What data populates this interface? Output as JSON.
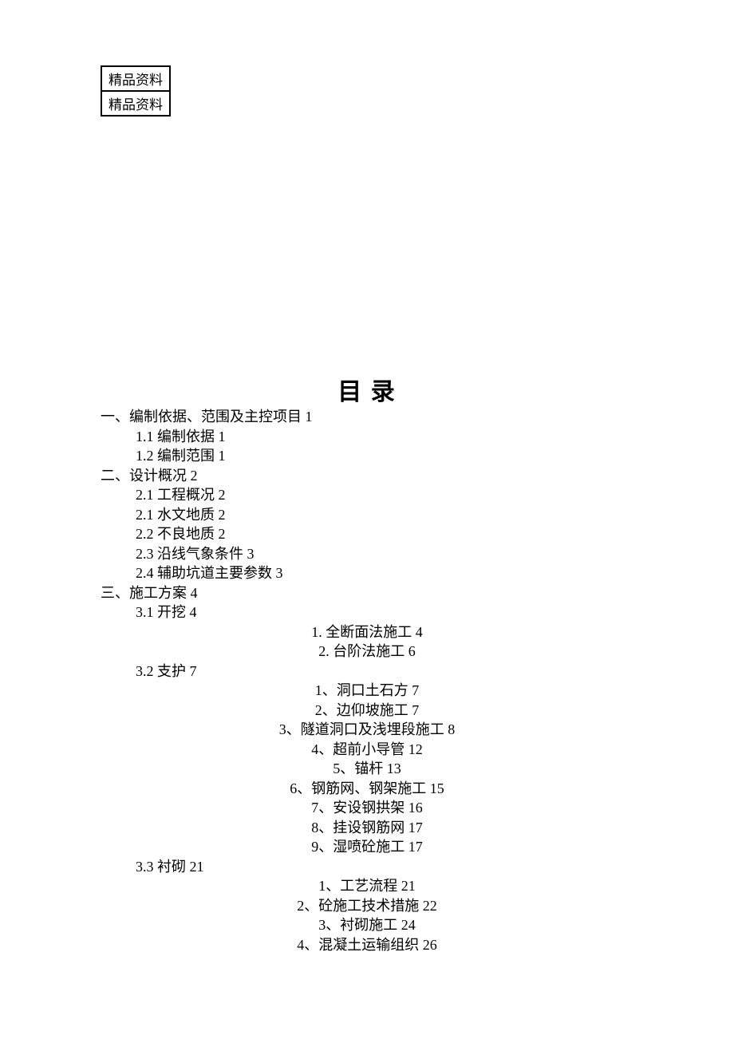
{
  "stamp": {
    "row1": "精品资料",
    "row2": "精品资料"
  },
  "title": "目 录",
  "toc": [
    {
      "cls": "lvl1",
      "text": "一、编制依据、范围及主控项目 1"
    },
    {
      "cls": "lvl2",
      "text": "1.1 编制依据 1"
    },
    {
      "cls": "lvl2",
      "text": "1.2 编制范围 1"
    },
    {
      "cls": "lvl1",
      "text": "二、设计概况 2"
    },
    {
      "cls": "lvl2",
      "text": "2.1 工程概况 2"
    },
    {
      "cls": "lvl2",
      "text": "2.1 水文地质 2"
    },
    {
      "cls": "lvl2",
      "text": "2.2 不良地质 2"
    },
    {
      "cls": "lvl2",
      "text": "2.3 沿线气象条件 3"
    },
    {
      "cls": "lvl2",
      "text": "2.4 辅助坑道主要参数 3"
    },
    {
      "cls": "lvl1",
      "text": "三、施工方案 4"
    },
    {
      "cls": "lvl2",
      "text": "3.1 开挖 4"
    },
    {
      "cls": "lvl3",
      "text": "1. 全断面法施工 4"
    },
    {
      "cls": "lvl3",
      "text": "2. 台阶法施工 6"
    },
    {
      "cls": "lvl2",
      "text": "3.2 支护 7"
    },
    {
      "cls": "lvl3",
      "text": "1、洞口土石方 7"
    },
    {
      "cls": "lvl3",
      "text": "2、边仰坡施工 7"
    },
    {
      "cls": "lvl3",
      "text": "3、隧道洞口及浅埋段施工 8"
    },
    {
      "cls": "lvl3",
      "text": "4、超前小导管 12"
    },
    {
      "cls": "lvl3",
      "text": "5、锚杆 13"
    },
    {
      "cls": "lvl3",
      "text": "6、钢筋网、钢架施工 15"
    },
    {
      "cls": "lvl3",
      "text": "7、安设钢拱架 16"
    },
    {
      "cls": "lvl3",
      "text": "8、挂设钢筋网 17"
    },
    {
      "cls": "lvl3",
      "text": "9、湿喷砼施工 17"
    },
    {
      "cls": "lvl2",
      "text": "3.3 衬砌 21"
    },
    {
      "cls": "lvl3",
      "text": "1、工艺流程 21"
    },
    {
      "cls": "lvl3",
      "text": "2、砼施工技术措施 22"
    },
    {
      "cls": "lvl3",
      "text": "3、衬砌施工 24"
    },
    {
      "cls": "lvl3",
      "text": "4、混凝土运输组织 26"
    }
  ]
}
